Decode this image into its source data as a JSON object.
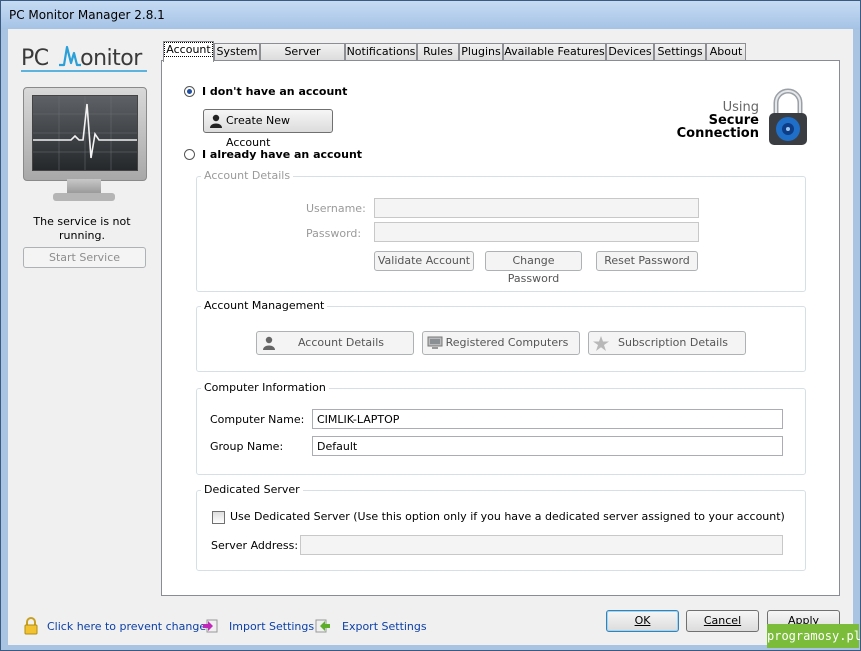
{
  "window": {
    "title": "PC Monitor Manager 2.8.1"
  },
  "sidebar": {
    "logo_left": "PC",
    "logo_right": "onitor",
    "service_status": "The service is not running.",
    "start_service_label": "Start Service"
  },
  "tabs": [
    {
      "label": "Account"
    },
    {
      "label": "System"
    },
    {
      "label": "Server Modules"
    },
    {
      "label": "Notifications"
    },
    {
      "label": "Rules"
    },
    {
      "label": "Plugins"
    },
    {
      "label": "Available Features"
    },
    {
      "label": "Devices"
    },
    {
      "label": "Settings"
    },
    {
      "label": "About"
    }
  ],
  "account": {
    "no_account_label": "I don't have an account",
    "create_account_label": "Create New Account",
    "have_account_label": "I already have an account",
    "secure": {
      "line1": "Using",
      "line2": "Secure",
      "line3": "Connection"
    },
    "details_group": "Account Details",
    "username_label": "Username:",
    "password_label": "Password:",
    "validate_label": "Validate Account",
    "change_password_label": "Change Password",
    "reset_password_label": "Reset Password",
    "management_group": "Account Management",
    "account_details_label": "Account Details",
    "registered_computers_label": "Registered Computers",
    "subscription_details_label": "Subscription Details",
    "computer_group": "Computer Information",
    "computer_name_label": "Computer Name:",
    "computer_name_value": "CIMLIK-LAPTOP",
    "group_name_label": "Group Name:",
    "group_name_value": "Default",
    "dedicated_group": "Dedicated Server",
    "dedicated_checkbox_label": "Use Dedicated Server (Use this option only if you have a dedicated server assigned to your account)",
    "server_address_label": "Server Address:"
  },
  "footer": {
    "prevent_changes": "Click here to prevent changes",
    "import_settings": "Import Settings",
    "export_settings": "Export Settings",
    "ok_label": "OK",
    "cancel_label": "Cancel",
    "apply_label": "Apply"
  },
  "watermark": "programosy.pl",
  "colors": {
    "accent": "#2a9fd8",
    "link": "#0b3fa8",
    "watermark": "#7bbd3a"
  }
}
